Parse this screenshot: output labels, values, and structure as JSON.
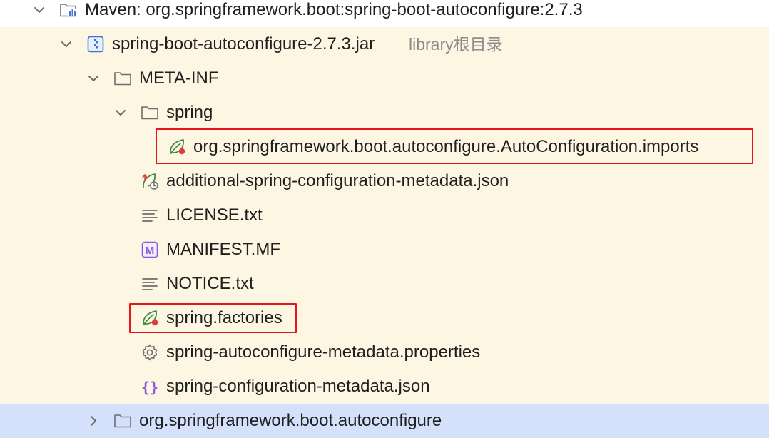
{
  "tree": {
    "rows": [
      {
        "label": "Maven: org.springframework.boot:spring-boot-autoconfigure:2.7.3",
        "icon": "library-folder-icon",
        "expanded": true
      },
      {
        "label": "spring-boot-autoconfigure-2.7.3.jar",
        "hint": "library根目录",
        "icon": "jar-archive-icon",
        "expanded": true
      },
      {
        "label": "META-INF",
        "icon": "folder-icon",
        "expanded": true
      },
      {
        "label": "spring",
        "icon": "folder-icon",
        "expanded": true
      },
      {
        "label": "org.springframework.boot.autoconfigure.AutoConfiguration.imports",
        "icon": "spring-factories-icon"
      },
      {
        "label": "additional-spring-configuration-metadata.json",
        "icon": "spring-metadata-json-icon"
      },
      {
        "label": "LICENSE.txt",
        "icon": "text-file-icon"
      },
      {
        "label": "MANIFEST.MF",
        "icon": "manifest-icon",
        "icon_letter": "M"
      },
      {
        "label": "NOTICE.txt",
        "icon": "text-file-icon"
      },
      {
        "label": "spring.factories",
        "icon": "spring-factories-icon"
      },
      {
        "label": "spring-autoconfigure-metadata.properties",
        "icon": "gear-icon"
      },
      {
        "label": "spring-configuration-metadata.json",
        "icon": "json-braces-icon",
        "icon_text": "{}"
      },
      {
        "label": "org.springframework.boot.autoconfigure",
        "icon": "folder-icon",
        "expanded": false,
        "selected": true
      }
    ]
  },
  "colors": {
    "band": "#fdf6e3",
    "selected": "#d5e1fb",
    "highlight": "#e8141a",
    "spring_green": "#3f8e45",
    "purple": "#8c5cd9",
    "hint": "#8c8c8c"
  }
}
